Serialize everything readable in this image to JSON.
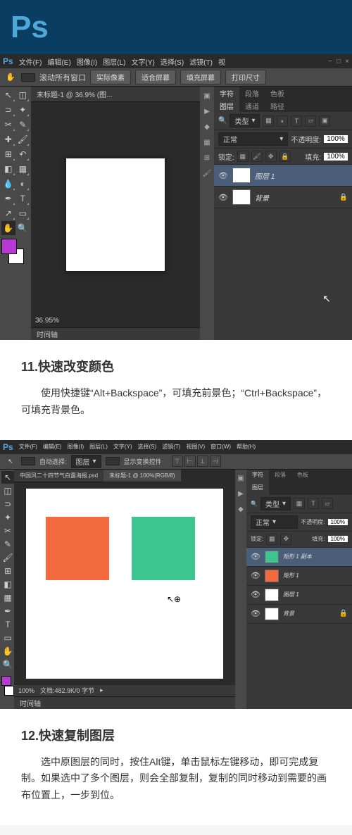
{
  "header": {
    "logo": "Ps"
  },
  "app1": {
    "logo": "Ps",
    "menu": [
      "文件(F)",
      "编辑(E)",
      "图像(I)",
      "图层(L)",
      "文字(Y)",
      "选择(S)",
      "滤镜(T)",
      "视"
    ],
    "options": {
      "scroll_all": "滚动所有窗口",
      "btns": [
        "实际像素",
        "适合屏幕",
        "填充屏幕",
        "打印尺寸"
      ]
    },
    "doc_tab": "未标题-1 @ 36.9% (图...",
    "zoom": "36.95%",
    "timeline": "时间轴",
    "char_panel": {
      "tabs": [
        "字符",
        "段落",
        "色板"
      ]
    },
    "layer_panel": {
      "tabs": [
        "图层",
        "通道",
        "路径"
      ],
      "kind": "类型",
      "blend": "正常",
      "opacity_lbl": "不透明度:",
      "opacity": "100%",
      "lock_lbl": "锁定:",
      "fill_lbl": "填充:",
      "fill": "100%",
      "layers": [
        {
          "name": "图层 1"
        },
        {
          "name": "背景"
        }
      ]
    }
  },
  "tip11": {
    "title": "11.快速改变颜色",
    "body": "使用快捷键“Alt+Backspace”，可填充前景色；“Ctrl+Backspace”，可填充背景色。"
  },
  "app2": {
    "logo": "Ps",
    "menu": [
      "文件(F)",
      "编辑(E)",
      "图像(I)",
      "图层(L)",
      "文字(Y)",
      "选择(S)",
      "滤镜(T)",
      "视图(V)",
      "窗口(W)",
      "帮助(H)"
    ],
    "options": {
      "auto_sel": "自动选择:",
      "group": "图层",
      "show_transform": "显示变换控件"
    },
    "doc_tabs": [
      "中国风二十四节气白露海报.psd",
      "未标题-1 @ 100%(RGB/8)"
    ],
    "status": {
      "zoom": "100%",
      "doc": "文档:482.9K/0 字节"
    },
    "timeline": "时间轴",
    "char_panel": {
      "tabs": [
        "字符",
        "段落",
        "色板"
      ]
    },
    "layer_panel": {
      "tabs": [
        "图层"
      ],
      "kind": "类型",
      "blend": "正常",
      "opacity_lbl": "不透明度:",
      "opacity": "100%",
      "lock_lbl": "锁定:",
      "fill_lbl": "填充:",
      "fill": "100%",
      "layers": [
        {
          "name": "矩形 1 副本",
          "color": "green"
        },
        {
          "name": "矩形 1",
          "color": "orange"
        },
        {
          "name": "图层 1",
          "color": "w"
        },
        {
          "name": "背景",
          "color": "w"
        }
      ]
    }
  },
  "tip12": {
    "title": "12.快速复制图层",
    "body": "选中原图层的同时，按住Alt键，单击鼠标左键移动，即可完成复制。如果选中了多个图层，则会全部复制，复制的同时移动到需要的画布位置上，一步到位。"
  }
}
